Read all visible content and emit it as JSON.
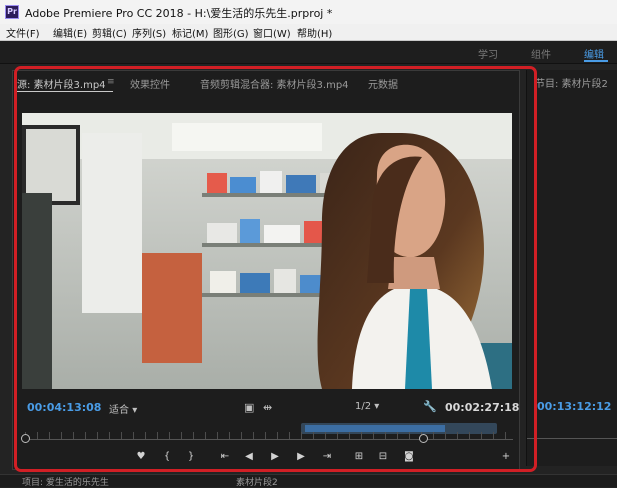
{
  "window": {
    "title": "Adobe Premiere Pro CC 2018 - H:\\爱生活的乐先生.prproj *",
    "app_icon": "Pr"
  },
  "menubar": {
    "items": [
      "文件(F)",
      "编辑(E)",
      "剪辑(C)",
      "序列(S)",
      "标记(M)",
      "图形(G)",
      "窗口(W)",
      "帮助(H)"
    ]
  },
  "workspace": {
    "tabs": [
      "学习",
      "组件",
      "编辑"
    ],
    "active": "编辑"
  },
  "source_panel": {
    "tabs": [
      "源: 素材片段3.mp4",
      "效果控件",
      "音频剪辑混合器: 素材片段3.mp4",
      "元数据"
    ],
    "menu_icon": "≡",
    "timecode_in": "00:04:13:08",
    "fit": "适合",
    "resolution": "1/2",
    "timecode_out": "00:02:27:18"
  },
  "program_panel": {
    "tab_label": "节目: 素材片段2",
    "menu_icon": "≡",
    "timecode": "00:13:12:12"
  },
  "bottom_bar": {
    "project_label": "项目: 爱生活的乐先生",
    "sequence_label": "素材片段2"
  },
  "colors": {
    "accent": "#4a9ce6",
    "highlight_box": "#d11f25"
  },
  "transport_icons": [
    "marker-icon",
    "mark-in-icon",
    "mark-out-icon",
    "go-to-in-icon",
    "step-back-icon",
    "play-icon",
    "step-forward-icon",
    "go-to-out-icon",
    "insert-icon",
    "overwrite-icon",
    "export-frame-icon",
    "add-button-icon"
  ]
}
